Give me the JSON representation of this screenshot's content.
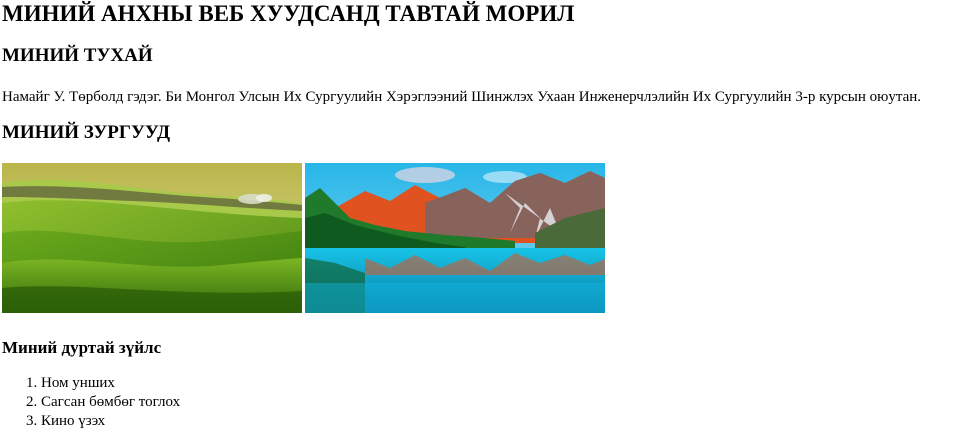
{
  "page": {
    "title": "МИНИЙ АНХНЫ ВЕБ ХУУДСАНД ТАВТАЙ МОРИЛ"
  },
  "about": {
    "heading": "МИНИЙ ТУХАЙ",
    "text": "Намайг У. Төрболд гэдэг. Би Монгол Улсын Их Сургуулийн Хэрэглээний Шинжлэх Ухаан Инженерчлэлийн Их Сургуулийн 3-р курсын оюутан."
  },
  "photos": {
    "heading": "МИНИЙ ЗУРГУУД",
    "items": [
      {
        "subject": "green rolling hills landscape",
        "palette": [
          "#3f8a12",
          "#6fb021",
          "#c9d36a"
        ]
      },
      {
        "subject": "mountain lake with reflection",
        "palette": [
          "#1bb8ea",
          "#1c6b2a",
          "#e0521f"
        ]
      }
    ]
  },
  "likes": {
    "heading": "Миний дуртай зүйлс",
    "items": [
      "Ном унших",
      "Сагсан бөмбөг тоглох",
      "Кино үзэх"
    ]
  }
}
